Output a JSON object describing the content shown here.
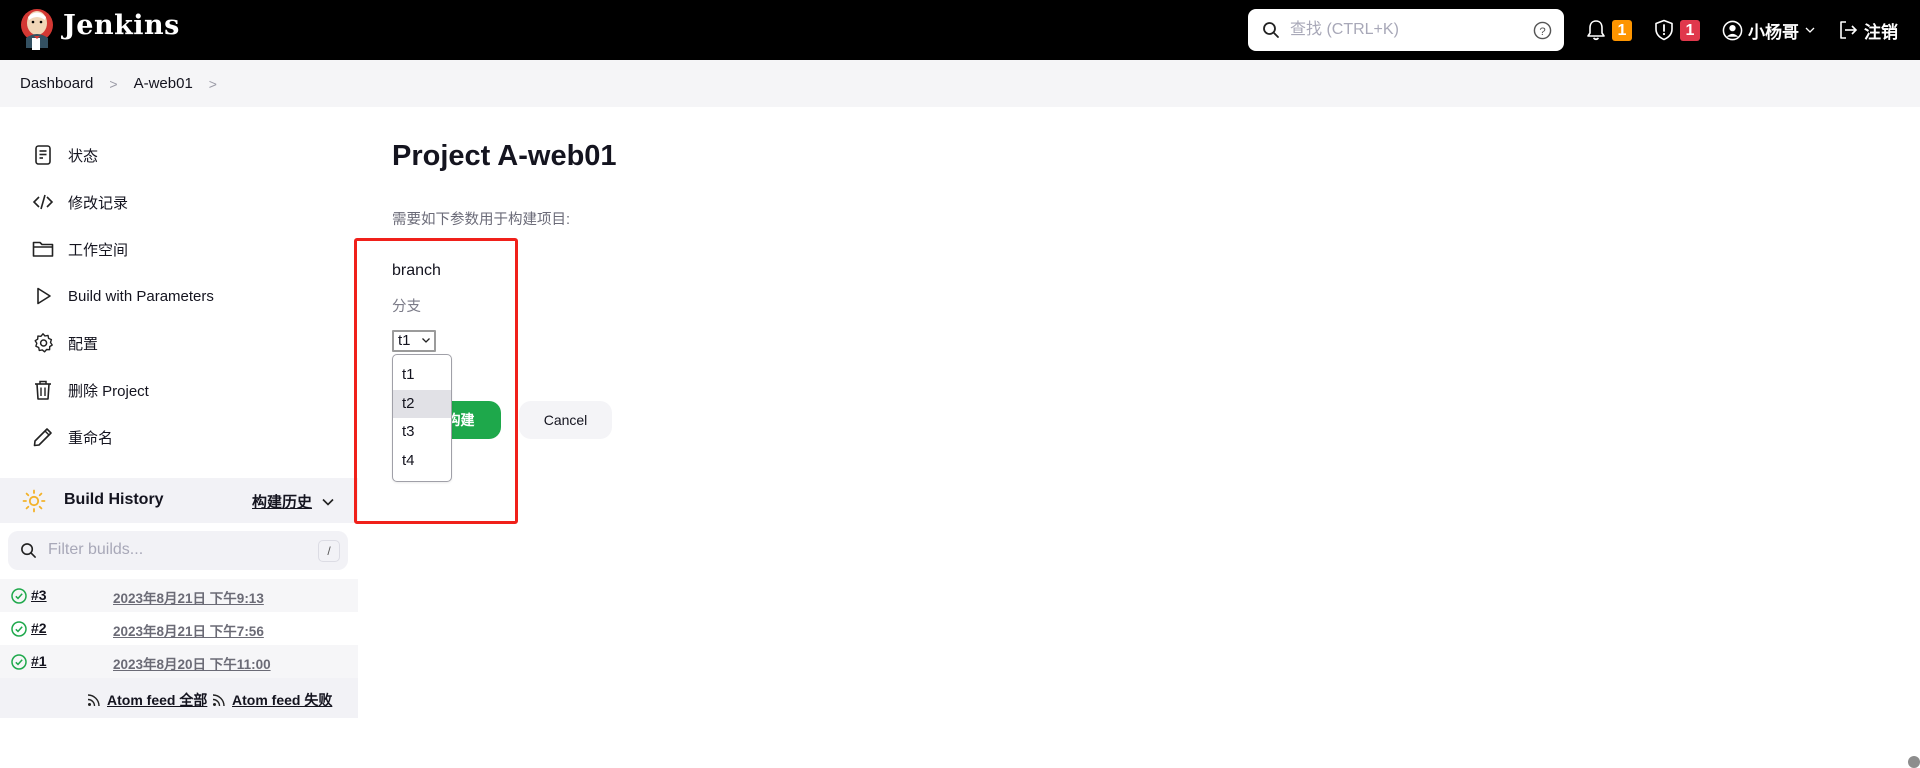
{
  "header": {
    "brand": "Jenkins",
    "search_placeholder": "查找 (CTRL+K)",
    "notifications_count": "1",
    "security_count": "1",
    "user_name": "小杨哥",
    "logout_label": "注销",
    "colors": {
      "notification_badge": "#fe9500",
      "security_badge": "#e0384c"
    }
  },
  "breadcrumb": {
    "items": [
      "Dashboard",
      "A-web01"
    ]
  },
  "sidebar": {
    "tasks": [
      {
        "label": "状态",
        "icon": "notepad-icon"
      },
      {
        "label": "修改记录",
        "icon": "code-icon"
      },
      {
        "label": "工作空间",
        "icon": "folder-icon"
      },
      {
        "label": "Build with Parameters",
        "icon": "play-icon"
      },
      {
        "label": "配置",
        "icon": "gear-icon"
      },
      {
        "label": "删除 Project",
        "icon": "trash-icon"
      },
      {
        "label": "重命名",
        "icon": "pencil-icon"
      }
    ]
  },
  "build_history": {
    "title": "Build History",
    "trend_label": "构建历史",
    "filter_placeholder": "Filter builds...",
    "filter_shortcut": "/",
    "builds": [
      {
        "number": "#3",
        "time": "2023年8月21日 下午9:13",
        "status": "success"
      },
      {
        "number": "#2",
        "time": "2023年8月21日 下午7:56",
        "status": "success"
      },
      {
        "number": "#1",
        "time": "2023年8月20日 下午11:00",
        "status": "success"
      }
    ],
    "feeds": [
      "Atom feed 全部",
      "Atom feed 失败"
    ]
  },
  "main": {
    "title": "Project A-web01",
    "description": "需要如下参数用于构建项目:",
    "parameter": {
      "name": "branch",
      "description": "分支",
      "selected": "t1",
      "options": [
        "t1",
        "t2",
        "t3",
        "t4"
      ],
      "highlighted_option": "t2"
    },
    "build_button": "开始构建",
    "cancel_button": "Cancel"
  }
}
